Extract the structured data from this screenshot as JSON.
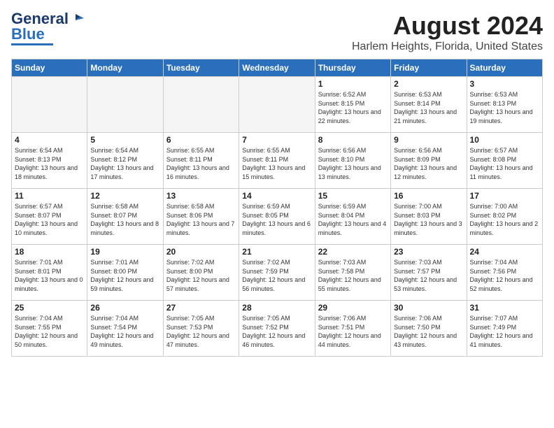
{
  "header": {
    "logo_general": "General",
    "logo_blue": "Blue",
    "month": "August 2024",
    "location": "Harlem Heights, Florida, United States"
  },
  "days_of_week": [
    "Sunday",
    "Monday",
    "Tuesday",
    "Wednesday",
    "Thursday",
    "Friday",
    "Saturday"
  ],
  "weeks": [
    [
      {
        "day": "",
        "empty": true
      },
      {
        "day": "",
        "empty": true
      },
      {
        "day": "",
        "empty": true
      },
      {
        "day": "",
        "empty": true
      },
      {
        "day": "1",
        "sunrise": "Sunrise: 6:52 AM",
        "sunset": "Sunset: 8:15 PM",
        "daylight": "Daylight: 13 hours and 22 minutes."
      },
      {
        "day": "2",
        "sunrise": "Sunrise: 6:53 AM",
        "sunset": "Sunset: 8:14 PM",
        "daylight": "Daylight: 13 hours and 21 minutes."
      },
      {
        "day": "3",
        "sunrise": "Sunrise: 6:53 AM",
        "sunset": "Sunset: 8:13 PM",
        "daylight": "Daylight: 13 hours and 19 minutes."
      }
    ],
    [
      {
        "day": "4",
        "sunrise": "Sunrise: 6:54 AM",
        "sunset": "Sunset: 8:13 PM",
        "daylight": "Daylight: 13 hours and 18 minutes."
      },
      {
        "day": "5",
        "sunrise": "Sunrise: 6:54 AM",
        "sunset": "Sunset: 8:12 PM",
        "daylight": "Daylight: 13 hours and 17 minutes."
      },
      {
        "day": "6",
        "sunrise": "Sunrise: 6:55 AM",
        "sunset": "Sunset: 8:11 PM",
        "daylight": "Daylight: 13 hours and 16 minutes."
      },
      {
        "day": "7",
        "sunrise": "Sunrise: 6:55 AM",
        "sunset": "Sunset: 8:11 PM",
        "daylight": "Daylight: 13 hours and 15 minutes."
      },
      {
        "day": "8",
        "sunrise": "Sunrise: 6:56 AM",
        "sunset": "Sunset: 8:10 PM",
        "daylight": "Daylight: 13 hours and 13 minutes."
      },
      {
        "day": "9",
        "sunrise": "Sunrise: 6:56 AM",
        "sunset": "Sunset: 8:09 PM",
        "daylight": "Daylight: 13 hours and 12 minutes."
      },
      {
        "day": "10",
        "sunrise": "Sunrise: 6:57 AM",
        "sunset": "Sunset: 8:08 PM",
        "daylight": "Daylight: 13 hours and 11 minutes."
      }
    ],
    [
      {
        "day": "11",
        "sunrise": "Sunrise: 6:57 AM",
        "sunset": "Sunset: 8:07 PM",
        "daylight": "Daylight: 13 hours and 10 minutes."
      },
      {
        "day": "12",
        "sunrise": "Sunrise: 6:58 AM",
        "sunset": "Sunset: 8:07 PM",
        "daylight": "Daylight: 13 hours and 8 minutes."
      },
      {
        "day": "13",
        "sunrise": "Sunrise: 6:58 AM",
        "sunset": "Sunset: 8:06 PM",
        "daylight": "Daylight: 13 hours and 7 minutes."
      },
      {
        "day": "14",
        "sunrise": "Sunrise: 6:59 AM",
        "sunset": "Sunset: 8:05 PM",
        "daylight": "Daylight: 13 hours and 6 minutes."
      },
      {
        "day": "15",
        "sunrise": "Sunrise: 6:59 AM",
        "sunset": "Sunset: 8:04 PM",
        "daylight": "Daylight: 13 hours and 4 minutes."
      },
      {
        "day": "16",
        "sunrise": "Sunrise: 7:00 AM",
        "sunset": "Sunset: 8:03 PM",
        "daylight": "Daylight: 13 hours and 3 minutes."
      },
      {
        "day": "17",
        "sunrise": "Sunrise: 7:00 AM",
        "sunset": "Sunset: 8:02 PM",
        "daylight": "Daylight: 13 hours and 2 minutes."
      }
    ],
    [
      {
        "day": "18",
        "sunrise": "Sunrise: 7:01 AM",
        "sunset": "Sunset: 8:01 PM",
        "daylight": "Daylight: 13 hours and 0 minutes."
      },
      {
        "day": "19",
        "sunrise": "Sunrise: 7:01 AM",
        "sunset": "Sunset: 8:00 PM",
        "daylight": "Daylight: 12 hours and 59 minutes."
      },
      {
        "day": "20",
        "sunrise": "Sunrise: 7:02 AM",
        "sunset": "Sunset: 8:00 PM",
        "daylight": "Daylight: 12 hours and 57 minutes."
      },
      {
        "day": "21",
        "sunrise": "Sunrise: 7:02 AM",
        "sunset": "Sunset: 7:59 PM",
        "daylight": "Daylight: 12 hours and 56 minutes."
      },
      {
        "day": "22",
        "sunrise": "Sunrise: 7:03 AM",
        "sunset": "Sunset: 7:58 PM",
        "daylight": "Daylight: 12 hours and 55 minutes."
      },
      {
        "day": "23",
        "sunrise": "Sunrise: 7:03 AM",
        "sunset": "Sunset: 7:57 PM",
        "daylight": "Daylight: 12 hours and 53 minutes."
      },
      {
        "day": "24",
        "sunrise": "Sunrise: 7:04 AM",
        "sunset": "Sunset: 7:56 PM",
        "daylight": "Daylight: 12 hours and 52 minutes."
      }
    ],
    [
      {
        "day": "25",
        "sunrise": "Sunrise: 7:04 AM",
        "sunset": "Sunset: 7:55 PM",
        "daylight": "Daylight: 12 hours and 50 minutes."
      },
      {
        "day": "26",
        "sunrise": "Sunrise: 7:04 AM",
        "sunset": "Sunset: 7:54 PM",
        "daylight": "Daylight: 12 hours and 49 minutes."
      },
      {
        "day": "27",
        "sunrise": "Sunrise: 7:05 AM",
        "sunset": "Sunset: 7:53 PM",
        "daylight": "Daylight: 12 hours and 47 minutes."
      },
      {
        "day": "28",
        "sunrise": "Sunrise: 7:05 AM",
        "sunset": "Sunset: 7:52 PM",
        "daylight": "Daylight: 12 hours and 46 minutes."
      },
      {
        "day": "29",
        "sunrise": "Sunrise: 7:06 AM",
        "sunset": "Sunset: 7:51 PM",
        "daylight": "Daylight: 12 hours and 44 minutes."
      },
      {
        "day": "30",
        "sunrise": "Sunrise: 7:06 AM",
        "sunset": "Sunset: 7:50 PM",
        "daylight": "Daylight: 12 hours and 43 minutes."
      },
      {
        "day": "31",
        "sunrise": "Sunrise: 7:07 AM",
        "sunset": "Sunset: 7:49 PM",
        "daylight": "Daylight: 12 hours and 41 minutes."
      }
    ]
  ]
}
